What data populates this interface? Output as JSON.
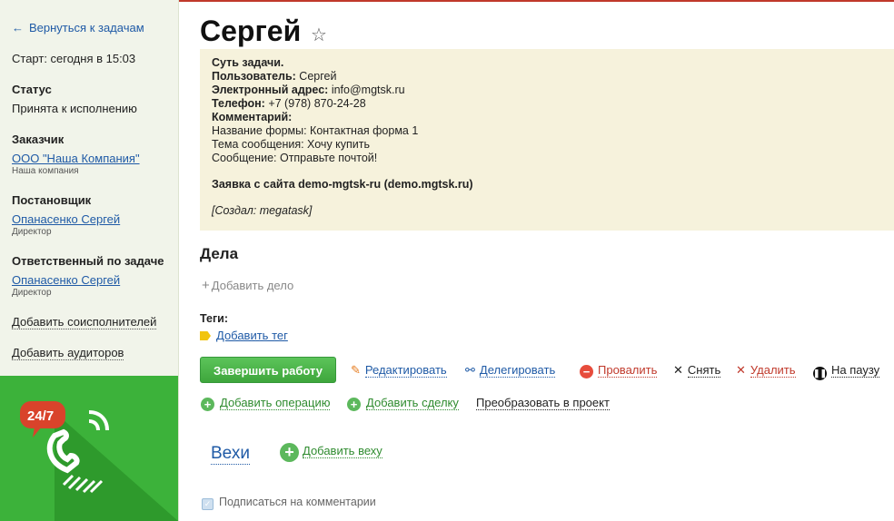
{
  "sidebar": {
    "back_label": "Вернуться к задачам",
    "start_label": "Старт: сегодня в 15:03",
    "status": {
      "heading": "Статус",
      "value": "Принята к исполнению"
    },
    "customer": {
      "heading": "Заказчик",
      "name": "ООО \"Наша Компания\"",
      "sub": "Наша компания"
    },
    "creator": {
      "heading": "Постановщик",
      "name": "Опанасенко Сергей",
      "sub": "Директор"
    },
    "responsible": {
      "heading": "Ответственный по задаче",
      "name": "Опанасенко Сергей",
      "sub": "Директор"
    },
    "add_coexecutors": "Добавить соисполнителей",
    "add_auditors": "Добавить аудиторов",
    "promo_badge": "24/7"
  },
  "main": {
    "title": "Сергей",
    "note": {
      "essence_label": "Суть задачи.",
      "user_label": "Пользователь:",
      "user_value": "Сергей",
      "email_label": "Электронный адрес:",
      "email_value": "info@mgtsk.ru",
      "phone_label": "Телефон:",
      "phone_value": "+7 (978) 870-24-28",
      "comment_label": "Комментарий:",
      "form_line": "Название формы: Контактная форма 1",
      "subject_line": "Тема сообщения: Хочу купить",
      "message_line": "Сообщение: Отправьте почтой!",
      "request_line": "Заявка с сайта demo-mgtsk-ru (demo.mgtsk.ru)",
      "created_line": "[Создал: megatask]"
    },
    "deals_heading": "Дела",
    "add_deal": "Добавить дело",
    "tags_label": "Теги:",
    "add_tag": "Добавить тег",
    "actions": {
      "finish": "Завершить работу",
      "edit": "Редактировать",
      "delegate": "Делегировать",
      "fail": "Провалить",
      "remove": "Снять",
      "delete": "Удалить",
      "pause": "На паузу"
    },
    "actions2": {
      "add_operation": "Добавить операцию",
      "add_deal": "Добавить сделку",
      "convert": "Преобразовать в проект"
    },
    "milestones": "Вехи",
    "add_milestone": "Добавить веху",
    "subscribe": "Подписаться на комментарии"
  },
  "colors": {
    "accent_green": "#3cb23a",
    "link_blue": "#1f5aa6",
    "danger_red": "#e74c3c",
    "note_bg": "#f6f2dc"
  }
}
